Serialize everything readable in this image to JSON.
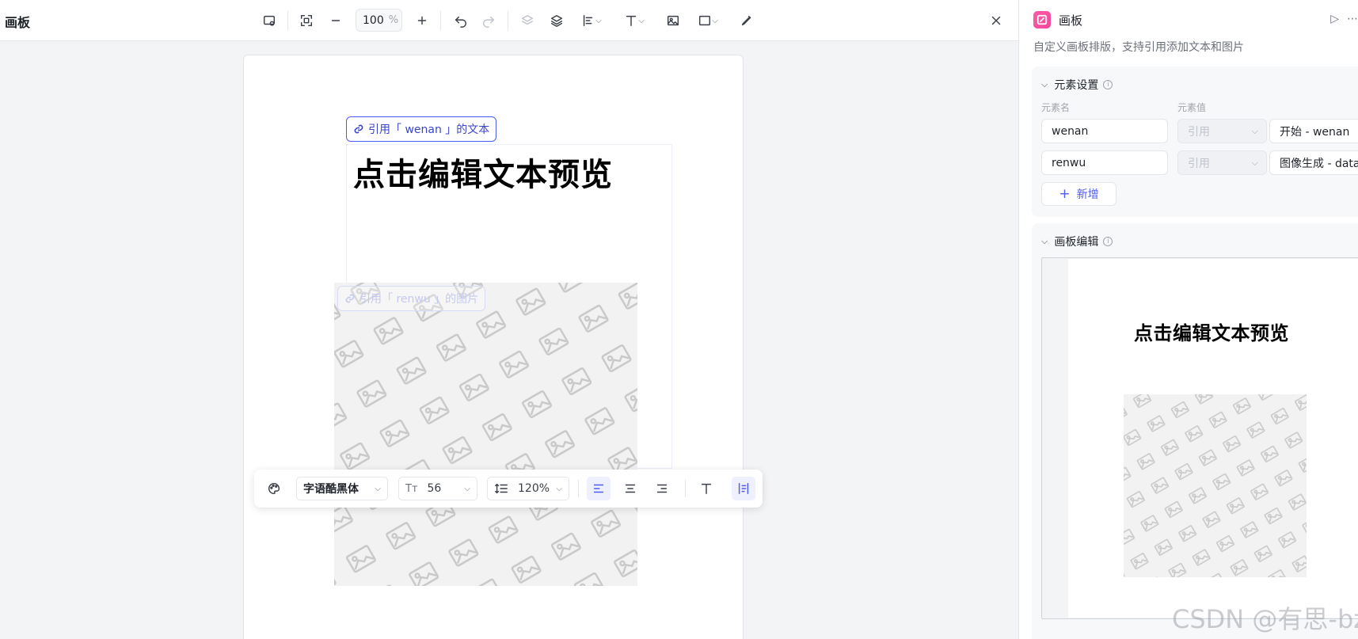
{
  "app": {
    "title": "画板"
  },
  "toolbar": {
    "zoom_value": "100",
    "zoom_unit": "%",
    "icons": [
      "canvas-settings-icon",
      "fit-screen-icon",
      "zoom-out-icon",
      "zoom-in-icon",
      "undo-icon",
      "redo-icon",
      "layer-down-icon",
      "layers-icon",
      "align-icon",
      "text-icon",
      "image-icon",
      "shape-icon",
      "pen-icon",
      "close-icon"
    ]
  },
  "canvas": {
    "text_ref_chip": "引用「 wenan 」的文本",
    "image_ref_chip": "引用「 renwu 」的图片",
    "text_content": "点击编辑文本预览"
  },
  "text_toolbar": {
    "font": "字语酷黑体",
    "font_size": "56",
    "line_height": "120%"
  },
  "panel": {
    "title": "画板",
    "description": "自定义画板排版，支持引用添加文本和图片",
    "element_section": {
      "title": "元素设置",
      "col_name": "元素名",
      "col_value": "元素值",
      "rows": [
        {
          "name": "wenan",
          "mode": "引用",
          "value": "开始 - wenan"
        },
        {
          "name": "renwu",
          "mode": "引用",
          "value": "图像生成 - data"
        }
      ],
      "add_label": "新增"
    },
    "canvas_section": {
      "title": "画板编辑",
      "preview_text": "点击编辑文本预览"
    }
  },
  "watermark": "CSDN @有思-bz",
  "colors": {
    "accent": "#4e5bf2",
    "brand_pink": "#f0479a"
  }
}
